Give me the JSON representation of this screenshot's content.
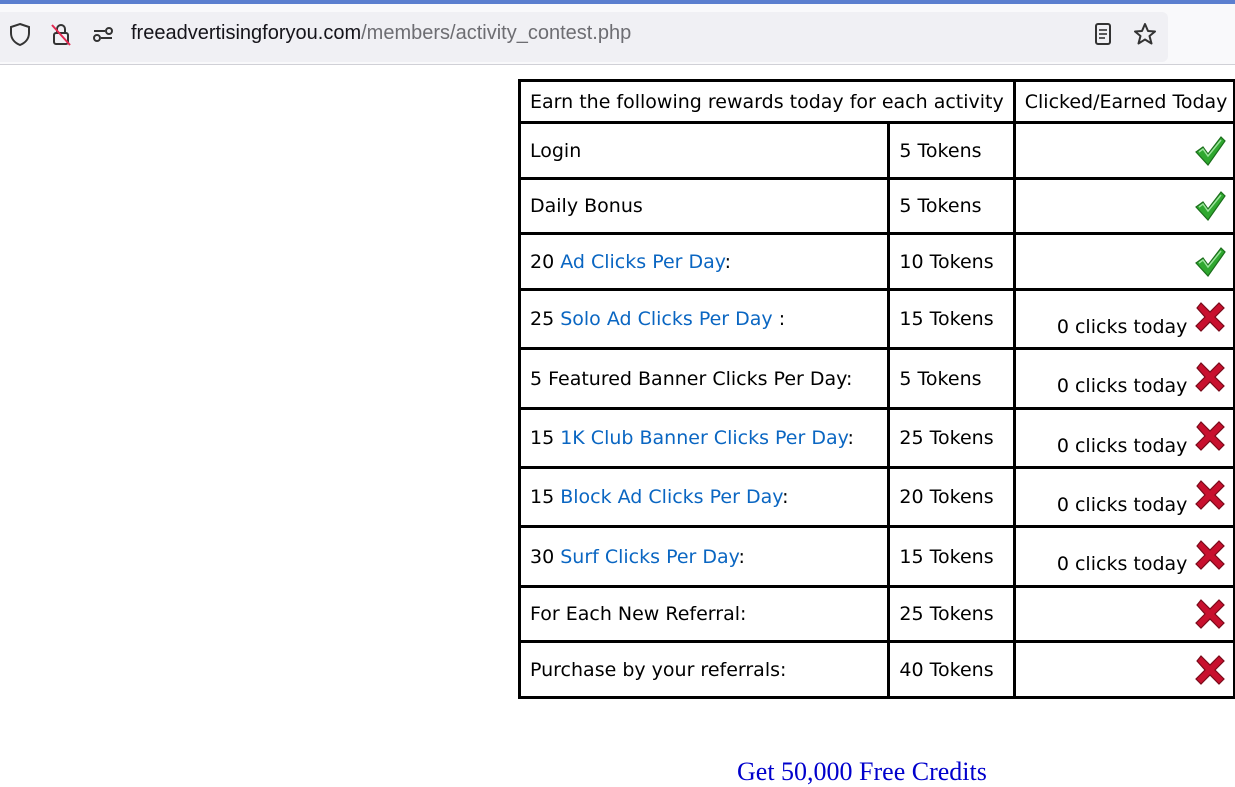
{
  "browser": {
    "url_domain": "freeadvertisingforyou.com",
    "url_path": "/members/activity_contest.php"
  },
  "table": {
    "header": [
      "Earn the following rewards today for each activity",
      "Clicked/Earned Today"
    ],
    "rows": [
      {
        "pre": "Login",
        "link": "",
        "post": "",
        "reward": "5 Tokens",
        "status": "check",
        "count": ""
      },
      {
        "pre": "Daily Bonus",
        "link": "",
        "post": "",
        "reward": "5 Tokens",
        "status": "check",
        "count": ""
      },
      {
        "pre": "20 ",
        "link": "Ad Clicks Per Day",
        "post": ":",
        "reward": "10 Tokens",
        "status": "check",
        "count": ""
      },
      {
        "pre": "25 ",
        "link": "Solo Ad Clicks Per Day",
        "post": " :",
        "reward": "15 Tokens",
        "status": "cross",
        "count": "0 clicks today"
      },
      {
        "pre": "5 Featured Banner Clicks Per Day:",
        "link": "",
        "post": "",
        "reward": "5 Tokens",
        "status": "cross",
        "count": "0 clicks today"
      },
      {
        "pre": "15 ",
        "link": "1K Club Banner Clicks Per Day",
        "post": ":",
        "reward": "25 Tokens",
        "status": "cross",
        "count": "0 clicks today"
      },
      {
        "pre": "15 ",
        "link": "Block Ad Clicks Per Day",
        "post": ":",
        "reward": "20 Tokens",
        "status": "cross",
        "count": "0 clicks today"
      },
      {
        "pre": "30 ",
        "link": "Surf Clicks Per Day",
        "post": ":",
        "reward": "15 Tokens",
        "status": "cross",
        "count": "0 clicks today"
      },
      {
        "pre": "For Each New Referral:",
        "link": "",
        "post": "",
        "reward": "25 Tokens",
        "status": "cross",
        "count": ""
      },
      {
        "pre": "Purchase by your referrals:",
        "link": "",
        "post": "",
        "reward": "40 Tokens",
        "status": "cross",
        "count": ""
      }
    ]
  },
  "footer_link": "Get 50,000 Free Credits",
  "colors": {
    "link": "#0a66c2",
    "check": "#2fa82f",
    "cross": "#c8102e"
  }
}
